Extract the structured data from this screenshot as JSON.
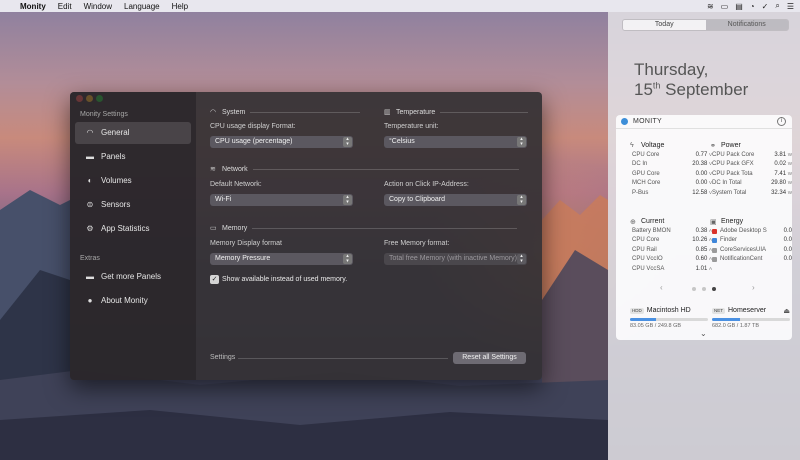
{
  "menubar": {
    "app_name": "Monity",
    "items": [
      "Edit",
      "Window",
      "Language",
      "Help"
    ]
  },
  "sidebar": {
    "title": "Monity Settings",
    "items": [
      {
        "label": "General",
        "icon": "gauge-icon"
      },
      {
        "label": "Panels",
        "icon": "panels-icon"
      },
      {
        "label": "Volumes",
        "icon": "volumes-icon"
      },
      {
        "label": "Sensors",
        "icon": "sensors-icon"
      },
      {
        "label": "App Statistics",
        "icon": "gear-icon"
      }
    ],
    "extras_title": "Extras",
    "extras": [
      {
        "label": "Get more Panels",
        "icon": "panels-plus-icon"
      },
      {
        "label": "About Monity",
        "icon": "info-icon"
      }
    ]
  },
  "settings": {
    "system": {
      "title": "System",
      "cpu_label": "CPU usage display Format:",
      "cpu_value": "CPU usage (percentage)"
    },
    "temperature": {
      "title": "Temperature",
      "unit_label": "Temperature unit:",
      "unit_value": "°Celsius"
    },
    "network": {
      "title": "Network",
      "default_label": "Default Network:",
      "default_value": "Wi-Fi",
      "action_label": "Action on Click IP-Address:",
      "action_value": "Copy to Clipboard"
    },
    "memory": {
      "title": "Memory",
      "display_label": "Memory Display format",
      "display_value": "Memory Pressure",
      "free_label": "Free Memory format:",
      "free_value": "Total free Memory (with inactive Memory)",
      "checkbox_label": "Show available instead of used memory.",
      "checkbox_checked": true
    },
    "footer": {
      "label": "Settings",
      "reset_button": "Reset all Settings"
    }
  },
  "notification_center": {
    "tabs": [
      "Today",
      "Notifications"
    ],
    "active_tab": "Today",
    "day": "Thursday,",
    "date_num": "15",
    "date_suffix": "th",
    "month": "September",
    "widget": {
      "name": "MONITY",
      "info_glyph": "i",
      "voltage": {
        "title": "Voltage",
        "rows": [
          {
            "label": "CPU Core",
            "value": "0.77",
            "unit": "V"
          },
          {
            "label": "DC In",
            "value": "20.38",
            "unit": "V"
          },
          {
            "label": "GPU Core",
            "value": "0.00",
            "unit": "V"
          },
          {
            "label": "MCH Core",
            "value": "0.00",
            "unit": "V"
          },
          {
            "label": "P-Bus",
            "value": "12.58",
            "unit": "V"
          }
        ]
      },
      "power": {
        "title": "Power",
        "rows": [
          {
            "label": "CPU Pack Core",
            "value": "3.81",
            "unit": "W"
          },
          {
            "label": "CPU Pack GFX",
            "value": "0.02",
            "unit": "W"
          },
          {
            "label": "CPU Pack Tota",
            "value": "7.41",
            "unit": "W"
          },
          {
            "label": "DC In Total",
            "value": "29.80",
            "unit": "W"
          },
          {
            "label": "System Total",
            "value": "32.34",
            "unit": "W"
          }
        ]
      },
      "current": {
        "title": "Current",
        "rows": [
          {
            "label": "Battery BMON",
            "value": "0.38",
            "unit": "A"
          },
          {
            "label": "CPU Core",
            "value": "10.26",
            "unit": "A"
          },
          {
            "label": "CPU Rail",
            "value": "0.85",
            "unit": "A"
          },
          {
            "label": "CPU VccIO",
            "value": "0.60",
            "unit": "A"
          },
          {
            "label": "CPU VccSA",
            "value": "1.01",
            "unit": "A"
          }
        ]
      },
      "energy": {
        "title": "Energy",
        "rows": [
          {
            "label": "Adobe Desktop S",
            "value": "0.0",
            "color": "#d9322b"
          },
          {
            "label": "Finder",
            "value": "0.0",
            "color": "#3f86d9"
          },
          {
            "label": "CoreServicesUIA",
            "value": "0.0",
            "color": "#9a9a9a"
          },
          {
            "label": "NotificationCent",
            "value": "0.0",
            "color": "#9a9a9a"
          }
        ]
      },
      "pager": {
        "prev": "‹",
        "next": "›"
      },
      "drives": [
        {
          "tag": "HDD",
          "name": "Macintosh HD",
          "info": "83.05 GB / 249.8 GB",
          "fraction": 0.33
        },
        {
          "tag": "NET",
          "name": "Homeserver",
          "info": "682.0 GB / 1.87 TB",
          "fraction": 0.36,
          "eject": "⏏"
        }
      ],
      "more_glyph": "⌄"
    }
  }
}
